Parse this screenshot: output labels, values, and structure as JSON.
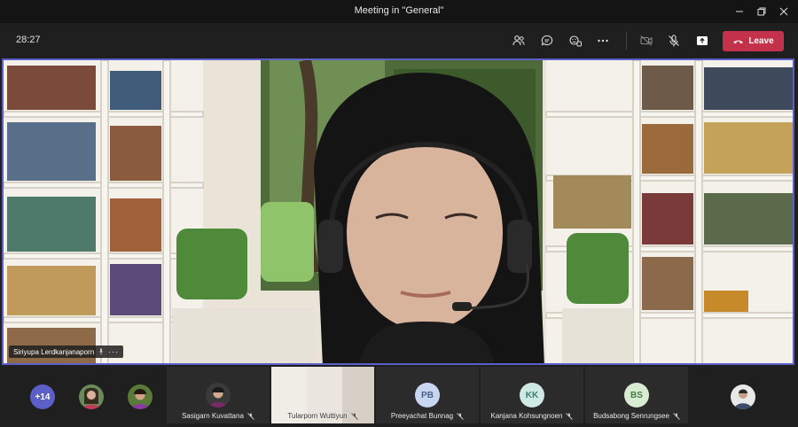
{
  "window": {
    "title": "Meeting in \"General\""
  },
  "toolbar": {
    "timer": "28:27",
    "leave_label": "Leave",
    "accent": "#c4314b"
  },
  "stage": {
    "speaker_name": "Siriyupa Lerdkanjanaporn",
    "more": "···"
  },
  "participants": {
    "overflow_count": "+14",
    "tiles": [
      {
        "name": "Sasigarn Kuvattana",
        "initials": "",
        "color": ""
      },
      {
        "name": "Tularporn Wuttiyun",
        "initials": "",
        "color": ""
      },
      {
        "name": "Preeyachat Bunnag",
        "initials": "PB",
        "color": "#c9d6f2"
      },
      {
        "name": "Kanjana Kohsungnoen",
        "initials": "KK",
        "color": "#cfe9e5"
      },
      {
        "name": "Budsabong Senrungsee",
        "initials": "BS",
        "color": "#d7ecd3"
      }
    ]
  }
}
